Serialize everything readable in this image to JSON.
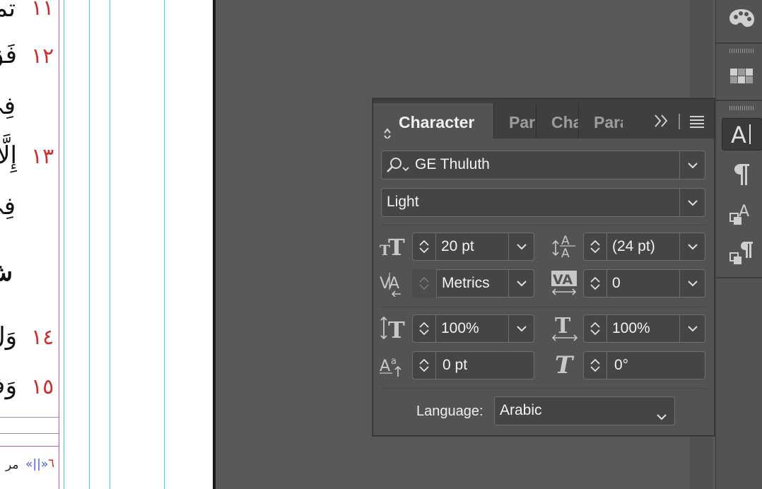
{
  "document": {
    "arabic_lines": [
      "تم",
      "فَقَ",
      "فِيَ",
      "إِلَّا",
      "فِيَ",
      "شِ",
      "وَلَ",
      "وَفُ"
    ],
    "verse_numbers": [
      "١١",
      "١٢",
      "١٣",
      "١٤",
      "١٥"
    ],
    "footer_arrows": "«||»",
    "footer_text": "مر",
    "footer_number": "٦"
  },
  "panel": {
    "tabs": [
      {
        "label": "Character",
        "active": true
      },
      {
        "label": "Par",
        "active": false
      },
      {
        "label": "Cha",
        "active": false
      },
      {
        "label": "Para",
        "active": false
      }
    ],
    "font_family": "GE Thuluth",
    "font_style": "Light",
    "font_size": "20 pt",
    "leading": "(24 pt)",
    "kerning": "Metrics",
    "tracking": "0",
    "vertical_scale": "100%",
    "horizontal_scale": "100%",
    "baseline_shift": "0 pt",
    "skew": "0°",
    "language_label": "Language:",
    "language": "Arabic"
  },
  "dock": {
    "buttons": [
      "palette-icon",
      "swatches-icon",
      "character-icon",
      "paragraph-icon",
      "character-styles-icon",
      "paragraph-styles-icon"
    ],
    "active": "character-icon"
  },
  "colors": {
    "panel_bg": "#535353",
    "field_bg": "#454545",
    "verse_number": "#cc2f2f",
    "guide_cyan": "#3fd3e0",
    "guide_magenta": "#c24fc8"
  }
}
